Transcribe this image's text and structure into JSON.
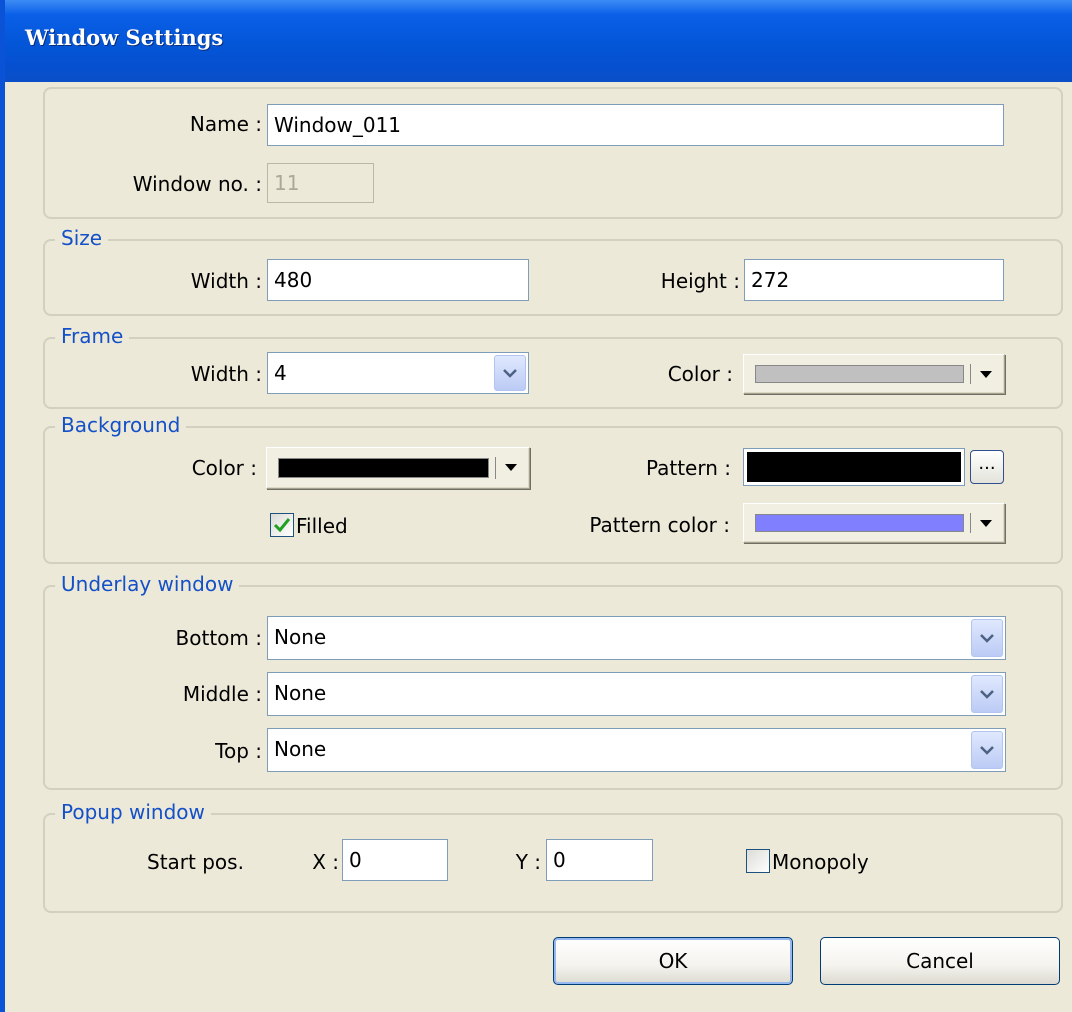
{
  "window": {
    "title": "Window Settings"
  },
  "general": {
    "name_label": "Name :",
    "name_value": "Window_011",
    "window_no_label": "Window no. :",
    "window_no_value": "11"
  },
  "size": {
    "legend": "Size",
    "width_label": "Width :",
    "width_value": "480",
    "height_label": "Height :",
    "height_value": "272"
  },
  "frame": {
    "legend": "Frame",
    "width_label": "Width :",
    "width_value": "4",
    "color_label": "Color :",
    "color_value": "#c0c0c0"
  },
  "background": {
    "legend": "Background",
    "color_label": "Color :",
    "color_value": "#000000",
    "pattern_label": "Pattern :",
    "pattern_value": "#000000",
    "pattern_button_label": "...",
    "filled_label": "Filled",
    "filled_checked": true,
    "pattern_color_label": "Pattern color :",
    "pattern_color_value": "#8080ff"
  },
  "underlay": {
    "legend": "Underlay window",
    "bottom_label": "Bottom :",
    "bottom_value": "None",
    "middle_label": "Middle :",
    "middle_value": "None",
    "top_label": "Top :",
    "top_value": "None"
  },
  "popup": {
    "legend": "Popup window",
    "start_pos_label": "Start pos.",
    "x_label": "X :",
    "x_value": "0",
    "y_label": "Y :",
    "y_value": "0",
    "monopoly_label": "Monopoly",
    "monopoly_checked": false
  },
  "buttons": {
    "ok_label": "OK",
    "cancel_label": "Cancel"
  },
  "colors": {
    "titlebar": "#0457d9",
    "dialog_bg": "#ece9d8",
    "legend_text": "#1450c8",
    "checkmark": "#21a121"
  },
  "icons": {
    "combo_arrow": "chevron-down-icon",
    "color_arrow": "triangle-down-icon",
    "check": "checkmark-icon"
  }
}
